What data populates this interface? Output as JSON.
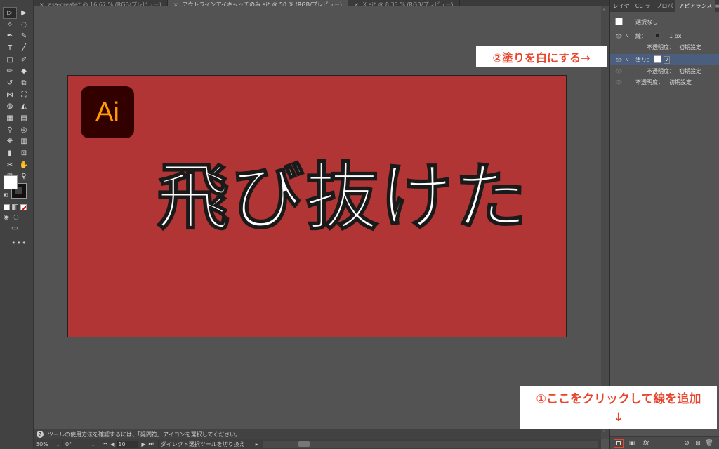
{
  "document_tabs": [
    {
      "close": "×",
      "label": "asa-create* @ 16.67 % (RGB/プレビュー)",
      "active": false
    },
    {
      "close": "×",
      "label": "アウトラインアイキャッチのみ.ai* @ 50 % (RGB/プレビュー)",
      "active": true
    },
    {
      "close": "×",
      "label": "X.ai* @ 8.33 % (RGB/プレビュー)",
      "active": false
    }
  ],
  "toolbar": {
    "more_tools": "•••"
  },
  "artboard": {
    "background_color": "#b23535",
    "logo_text": "Ai",
    "headline": "飛び抜けた"
  },
  "callouts": {
    "fill": "②塗りを白にする→",
    "stroke_line1": "①ここをクリックして線を追加",
    "stroke_line2": "↓",
    "color": "#e8452c"
  },
  "panel": {
    "tabs": [
      "レイヤ",
      "CC ラ",
      "プロパ",
      "アピアランス"
    ],
    "menu": "≡",
    "selection_label": "選択なし",
    "stroke": {
      "label": "線：",
      "value": "1 px"
    },
    "stroke_opacity": {
      "label": "不透明度：",
      "value": "初期設定"
    },
    "fill": {
      "label": "塗り："
    },
    "fill_opacity": {
      "label": "不透明度：",
      "value": "初期設定"
    },
    "opacity": {
      "label": "不透明度：",
      "value": "初期設定"
    }
  },
  "hint": {
    "help": "?",
    "text": "ツールの使用方法を確認するには、「疑問符」アイコンを選択してください。"
  },
  "status": {
    "zoom": "50%",
    "rotation": "0°",
    "page": "10",
    "tool_status": "ダイレクト選択ツールを切り換え"
  }
}
